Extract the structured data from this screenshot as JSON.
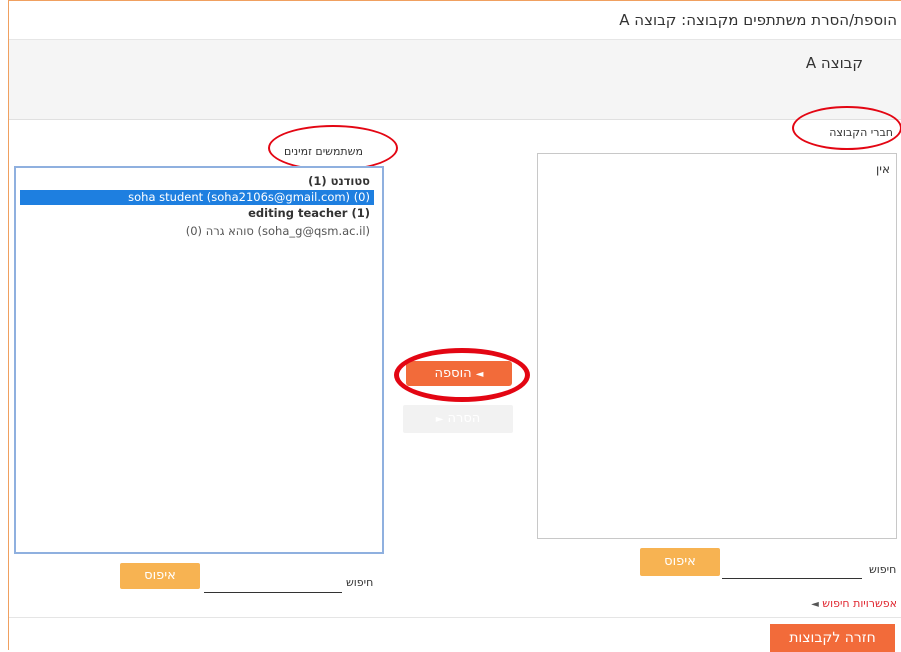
{
  "page": {
    "title": "הוספת/הסרת משתתפים מקבוצה: קבוצה A",
    "group_name": "קבוצה A"
  },
  "members": {
    "label": "חברי הקבוצה",
    "empty_text": "אין",
    "search_label": "חיפוש",
    "search_value": "",
    "reset_label": "איפוס",
    "search_options_label": "אפשרויות חיפוש"
  },
  "potential": {
    "label": "משתמשים זמינים",
    "options": [
      {
        "text": "סטודנט (1)",
        "kind": "group"
      },
      {
        "text": "soha student (soha2106s@gmail.com) (0)",
        "kind": "selected"
      },
      {
        "text": "editing teacher (1)",
        "kind": "group"
      },
      {
        "text": "סוהא גרה (0) (soha_g@qsm.ac.il)",
        "kind": "option"
      }
    ],
    "search_label": "חיפוש",
    "search_value": "",
    "reset_label": "איפוס"
  },
  "actions": {
    "add_label": "הוספה",
    "add_arrow": "◄",
    "remove_label": "הסרה",
    "remove_arrow": "►",
    "back_label": "חזרה לקבוצות",
    "options_arrow": "◄"
  },
  "colors": {
    "accent": "#f26b3a",
    "reset": "#f7b352",
    "selection": "#1e7fe0",
    "annotation": "#e30613"
  }
}
